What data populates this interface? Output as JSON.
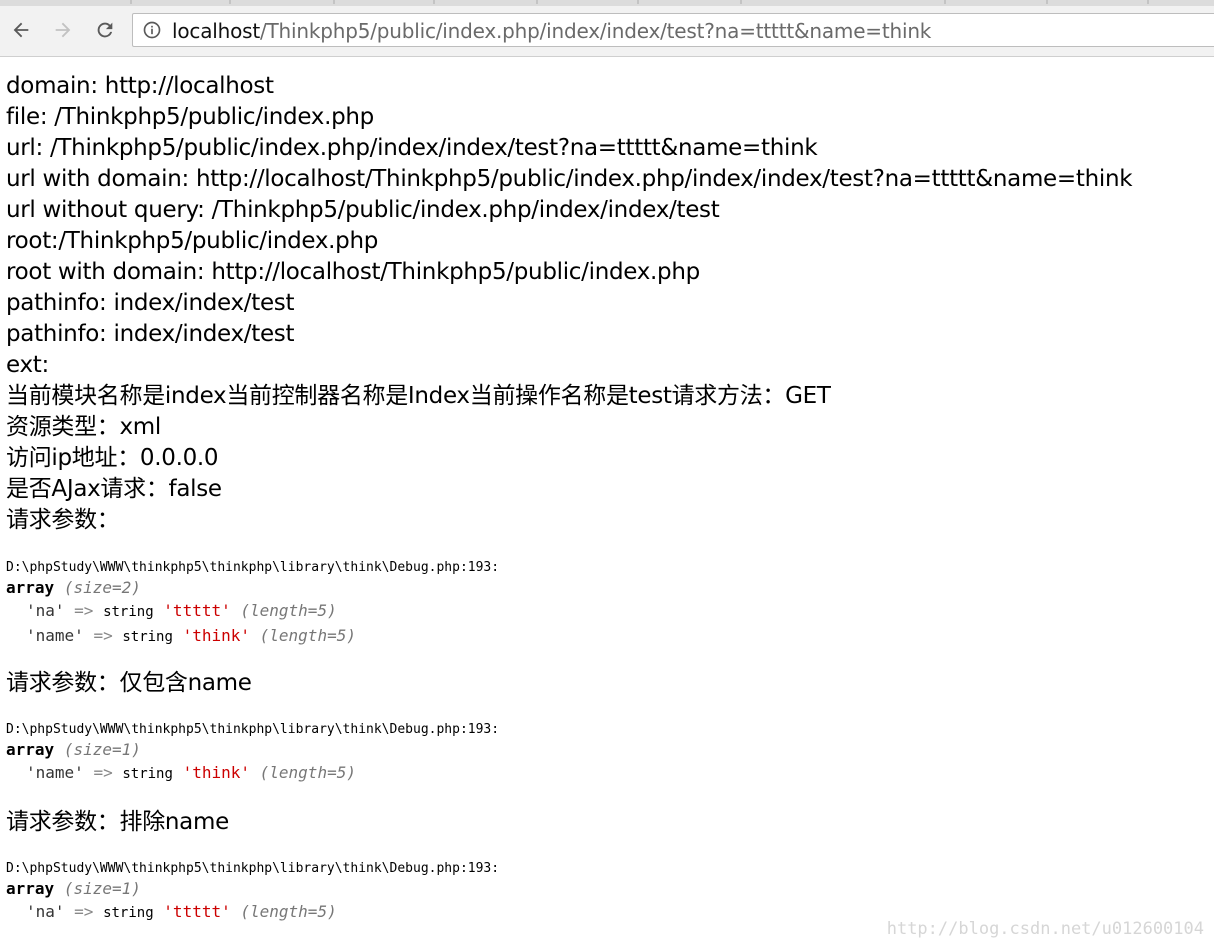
{
  "browser": {
    "url_host": "localhost",
    "url_path": "/Thinkphp5/public/index.php/index/index/test?na=ttttt&name=think",
    "icons": [
      "back-arrow-icon",
      "forward-arrow-icon",
      "reload-icon",
      "info-icon"
    ]
  },
  "page": {
    "lines": [
      "domain: http://localhost",
      "file: /Thinkphp5/public/index.php",
      "url: /Thinkphp5/public/index.php/index/index/test?na=ttttt&name=think",
      "url with domain: http://localhost/Thinkphp5/public/index.php/index/index/test?na=ttttt&name=think",
      "url without query: /Thinkphp5/public/index.php/index/index/test",
      "root:/Thinkphp5/public/index.php",
      "root with domain: http://localhost/Thinkphp5/public/index.php",
      "pathinfo: index/index/test",
      "pathinfo: index/index/test",
      "ext:",
      "当前模块名称是index当前控制器名称是Index当前操作名称是test请求方法：GET",
      "资源类型：xml",
      "访问ip地址：0.0.0.0",
      "是否AJax请求：false",
      "请求参数："
    ],
    "dumps": [
      {
        "file": "D:\\phpStudy\\WWW\\thinkphp5\\thinkphp\\library\\think\\Debug.php:193:",
        "array_label": "array",
        "size": "(size=2)",
        "entries": [
          {
            "key": "'na'",
            "arrow": "=>",
            "type": "string",
            "value": "'ttttt'",
            "length": "(length=5)"
          },
          {
            "key": "'name'",
            "arrow": "=>",
            "type": "string",
            "value": "'think'",
            "length": "(length=5)"
          }
        ]
      },
      {
        "file": "D:\\phpStudy\\WWW\\thinkphp5\\thinkphp\\library\\think\\Debug.php:193:",
        "array_label": "array",
        "size": "(size=1)",
        "entries": [
          {
            "key": "'name'",
            "arrow": "=>",
            "type": "string",
            "value": "'think'",
            "length": "(length=5)"
          }
        ]
      },
      {
        "file": "D:\\phpStudy\\WWW\\thinkphp5\\thinkphp\\library\\think\\Debug.php:193:",
        "array_label": "array",
        "size": "(size=1)",
        "entries": [
          {
            "key": "'na'",
            "arrow": "=>",
            "type": "string",
            "value": "'ttttt'",
            "length": "(length=5)"
          }
        ]
      }
    ],
    "heading_only_name": "请求参数：仅包含name",
    "heading_except_name": "请求参数：排除name"
  },
  "watermark": "http://blog.csdn.net/u012600104",
  "colors": {
    "string_value": "#cc0000",
    "meta": "#777777",
    "toolbar_bg": "#f2f2f2"
  }
}
